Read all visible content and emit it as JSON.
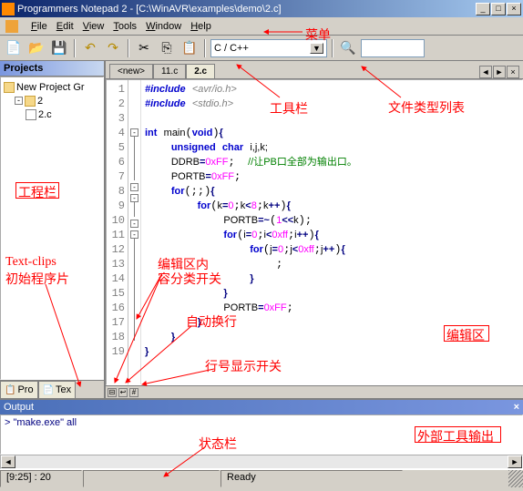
{
  "window": {
    "app_name": "Programmers Notepad 2",
    "file_path": "[C:\\WinAVR\\examples\\demo\\2.c]"
  },
  "menu": {
    "file": "File",
    "edit": "Edit",
    "view": "View",
    "tools": "Tools",
    "window": "Window",
    "help": "Help"
  },
  "toolbar": {
    "lang_combo": "C / C++"
  },
  "projects": {
    "header": "Projects",
    "root": "New Project Gr",
    "proj": "2",
    "file": "2.c",
    "tab_pro": "Pro",
    "tab_tex": "Tex"
  },
  "tabs": {
    "t1": "<new>",
    "t2": "11.c",
    "t3": "2.c"
  },
  "code": {
    "l1_a": "#include",
    "l1_b": "<avr/io.h>",
    "l2_a": "#include",
    "l2_b": "<stdio.h>",
    "l4_a": "int",
    "l4_b": "main",
    "l4_c": "void",
    "l5_a": "unsigned",
    "l5_b": "char",
    "l5_c": "i,j,k;",
    "l6_a": "DDRB",
    "l6_b": "0xFF",
    "l6_c": "//让PB口全部为输出口。",
    "l7_a": "PORTB",
    "l7_b": "0xFF",
    "l8_a": "for",
    "l9_a": "for",
    "l9_b": "k",
    "l9_c": "0",
    "l9_d": "k",
    "l9_e": "8",
    "l9_f": "k",
    "l10_a": "PORTB",
    "l10_b": "1",
    "l10_c": "k",
    "l11_a": "for",
    "l11_b": "i",
    "l11_c": "0",
    "l11_d": "i",
    "l11_e": "0xff",
    "l11_f": "i",
    "l12_a": "for",
    "l12_b": "j",
    "l12_c": "0",
    "l12_d": "j",
    "l12_e": "0xff",
    "l12_f": "j",
    "l16_a": "PORTB",
    "l16_b": "0xFF"
  },
  "output": {
    "header": "Output",
    "line1": "> \"make.exe\" all"
  },
  "status": {
    "pos": "[9:25] : 20",
    "ready": "Ready"
  },
  "annotations": {
    "menu": "菜单",
    "toolbar": "工具栏",
    "filetype": "文件类型列表",
    "project_pane": "工程栏",
    "textclips1": "Text-clips",
    "textclips2": "初始程序片",
    "fold_switch1": "编辑区内",
    "fold_switch2": "容分类开关",
    "wrap": "自动换行",
    "lineno": "行号显示开关",
    "editor": "编辑区",
    "statusbar": "状态栏",
    "output": "外部工具输出"
  }
}
